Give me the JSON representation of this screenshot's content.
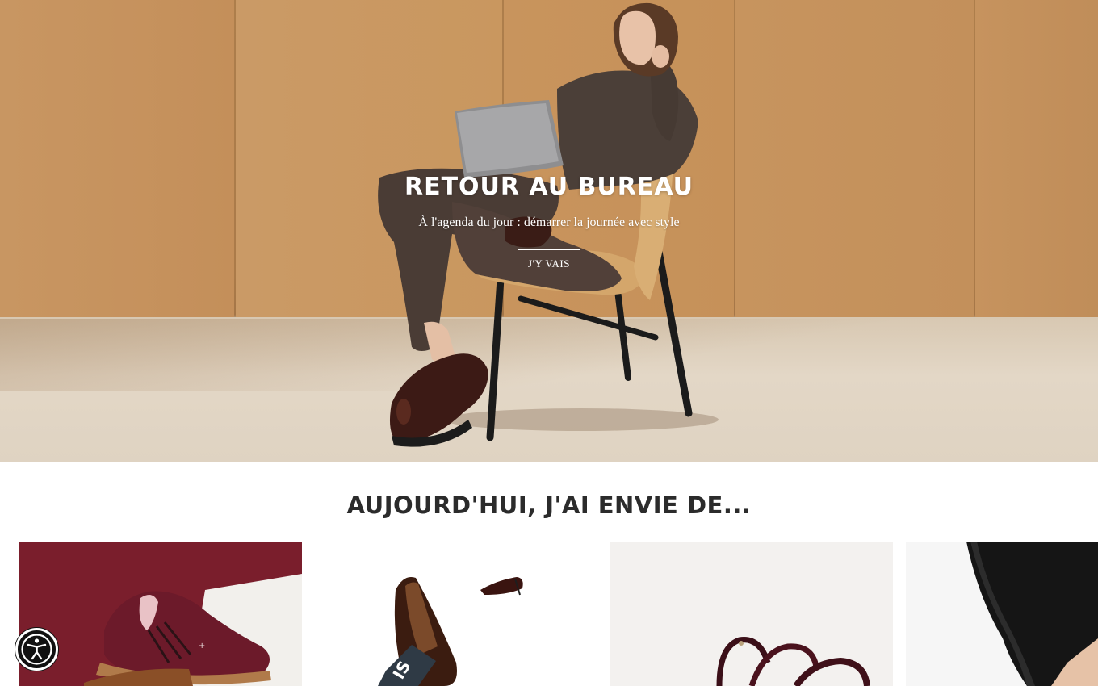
{
  "hero": {
    "title": "RETOUR AU BUREAU",
    "subtitle": "À l'agenda du jour : démarrer la journée avec style",
    "cta_label": "J'Y VAIS"
  },
  "section": {
    "title": "AUJOURD'HUI, J'AI ENVIE DE..."
  },
  "categories": [
    {
      "icon": "burgundy-sneaker-image"
    },
    {
      "icon": "loafer-and-pump-image"
    },
    {
      "icon": "burgundy-sandal-image"
    },
    {
      "icon": "black-trousers-image"
    }
  ],
  "accessibility": {
    "icon": "accessibility-icon"
  },
  "colors": {
    "hero_wood": "#c6925b",
    "card_burgundy": "#7a1e2c",
    "text_dark": "#2b2b2b",
    "white": "#ffffff"
  }
}
